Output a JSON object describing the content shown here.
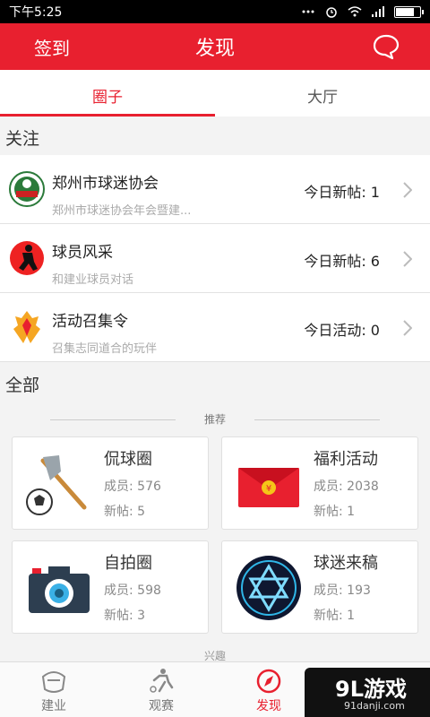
{
  "status": {
    "time": "下午5:25"
  },
  "header": {
    "left_label": "签到",
    "title": "发现"
  },
  "tabs": [
    {
      "label": "圈子"
    },
    {
      "label": "大厅"
    }
  ],
  "following": {
    "title": "关注",
    "items": [
      {
        "name": "郑州市球迷协会",
        "desc": "郑州市球迷协会年会暨建...",
        "count": "今日新帖: 1"
      },
      {
        "name": "球员风采",
        "desc": "和建业球员对话",
        "count": "今日新帖: 6"
      },
      {
        "name": "活动召集令",
        "desc": "召集志同道合的玩伴",
        "count": "今日活动: 0"
      }
    ]
  },
  "all": {
    "title": "全部",
    "recommend_label": "推荐",
    "cards": [
      {
        "name": "侃球圈",
        "members": "成员: 576",
        "new_posts": "新帖: 5",
        "icon": "axe-ball-icon"
      },
      {
        "name": "福利活动",
        "members": "成员: 2038",
        "new_posts": "新帖: 1",
        "icon": "red-envelope-icon"
      },
      {
        "name": "自拍圈",
        "members": "成员: 598",
        "new_posts": "新帖: 3",
        "icon": "camera-icon"
      },
      {
        "name": "球迷来稿",
        "members": "成员: 193",
        "new_posts": "新帖: 1",
        "icon": "star-badge-icon"
      }
    ],
    "interest_label": "兴趣"
  },
  "bottom_nav": [
    {
      "label": "建业"
    },
    {
      "label": "观赛"
    },
    {
      "label": "发现"
    }
  ],
  "watermark": {
    "brand": "9L游戏",
    "url": "91danji.com"
  },
  "colors": {
    "accent": "#e8202f"
  }
}
